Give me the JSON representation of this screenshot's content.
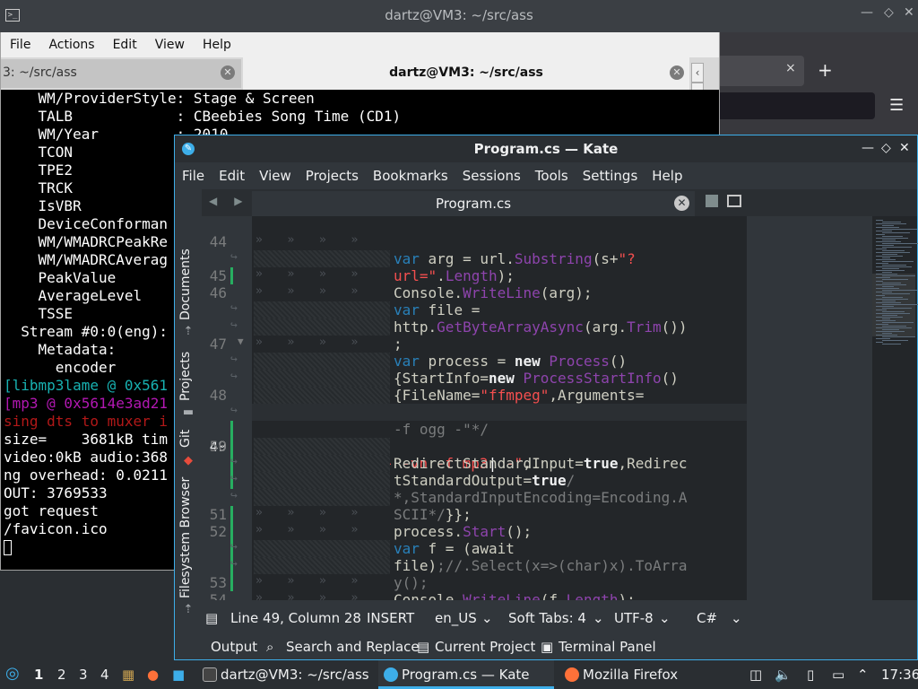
{
  "firefox": {
    "tab_close": "×",
    "new_tab": "+",
    "menu": "☰"
  },
  "konsole": {
    "title": "dartz@VM3: ~/src/ass",
    "menu": [
      "File",
      "Actions",
      "Edit",
      "View",
      "Help"
    ],
    "tab1_label": "3: ~/src/ass",
    "tab2_label": "dartz@VM3: ~/src/ass",
    "terminal_lines": [
      {
        "text": "    WM/ProviderStyle: Stage & Screen",
        "color": "#ffffff"
      },
      {
        "text": "    TALB            : CBeebies Song Time (CD1)",
        "color": "#ffffff"
      },
      {
        "text": "    WM/Year         : 2010",
        "color": "#ffffff"
      },
      {
        "text": "    TCON",
        "color": "#ffffff"
      },
      {
        "text": "    TPE2",
        "color": "#ffffff"
      },
      {
        "text": "    TRCK",
        "color": "#ffffff"
      },
      {
        "text": "    IsVBR",
        "color": "#ffffff"
      },
      {
        "text": "    DeviceConforman",
        "color": "#ffffff"
      },
      {
        "text": "    WM/WMADRCPeakRe",
        "color": "#ffffff"
      },
      {
        "text": "    WM/WMADRCAverag",
        "color": "#ffffff"
      },
      {
        "text": "    PeakValue",
        "color": "#ffffff"
      },
      {
        "text": "    AverageLevel",
        "color": "#ffffff"
      },
      {
        "text": "    TSSE",
        "color": "#ffffff"
      },
      {
        "text": "  Stream #0:0(eng):",
        "color": "#ffffff"
      },
      {
        "text": "    Metadata:",
        "color": "#ffffff"
      },
      {
        "text": "      encoder",
        "color": "#ffffff"
      },
      {
        "text": "[libmp3lame @ 0x561",
        "color": "#18b2b2"
      },
      {
        "text": "[mp3 @ 0x5614e3ad21",
        "color": "#b218b2"
      },
      {
        "text": "sing dts to muxer i",
        "color": "#b21818"
      },
      {
        "text": "size=    3681kB tim",
        "color": "#ffffff"
      },
      {
        "text": "video:0kB audio:368",
        "color": "#ffffff"
      },
      {
        "text": "ng overhead: 0.0211",
        "color": "#ffffff"
      },
      {
        "text": "OUT: 3769533",
        "color": "#ffffff"
      },
      {
        "text": "got request",
        "color": "#ffffff"
      },
      {
        "text": "/favicon.ico",
        "color": "#ffffff"
      }
    ]
  },
  "kate": {
    "title": "Program.cs — Kate",
    "menu": [
      "File",
      "Edit",
      "View",
      "Projects",
      "Bookmarks",
      "Sessions",
      "Tools",
      "Settings",
      "Help"
    ],
    "side_tabs": [
      "Documents",
      "Projects",
      "Git",
      "Filesystem Browser"
    ],
    "doc_tab": "Program.cs",
    "status": {
      "position": "Line 49, Column 28",
      "mode": "INSERT",
      "language": "en_US",
      "indent": "Soft Tabs: 4",
      "encoding": "UTF-8",
      "syntax": "C#"
    },
    "bottom_tools": [
      "Output",
      "Search and Replace",
      "Current Project",
      "Terminal Panel"
    ]
  },
  "taskbar": {
    "desktops": [
      "1",
      "2",
      "3",
      "4"
    ],
    "windows": [
      "dartz@VM3: ~/src/ass",
      "Program.cs — Kate",
      "Mozilla Firefox"
    ],
    "clock": "17:36"
  }
}
